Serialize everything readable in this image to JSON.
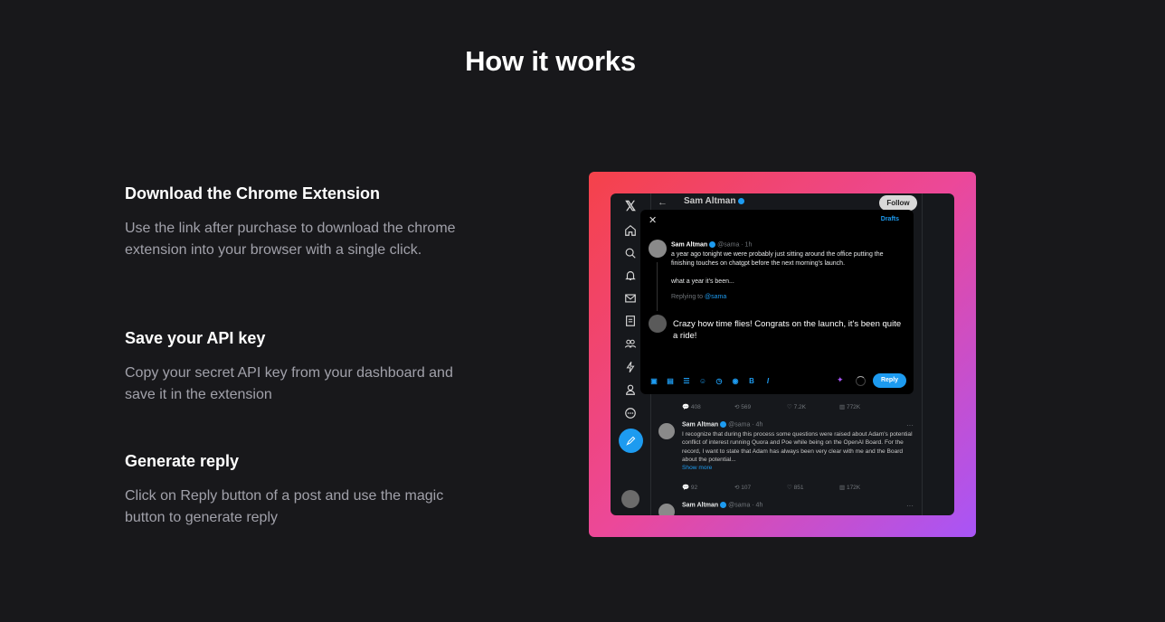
{
  "page": {
    "title": "How it works"
  },
  "steps": [
    {
      "title": "Download the Chrome Extension",
      "description": "Use the link after purchase to download the chrome extension into your browser with a single click."
    },
    {
      "title": "Save your API key",
      "description": "Copy your secret API key from your dashboard and save it in the extension"
    },
    {
      "title": "Generate reply",
      "description": "Click on Reply button of a post and use the magic button to generate reply"
    }
  ],
  "colors": {
    "background": "#18181b",
    "gradient_start": "#f5424a",
    "gradient_mid": "#ec4899",
    "gradient_end": "#a855f7",
    "twitter_blue": "#1d9bf0"
  },
  "screenshot": {
    "header_name": "Sam Altman",
    "follow_label": "Follow",
    "back_icon": "arrow-left-icon",
    "sidebar_icons": [
      "x-logo-icon",
      "home-icon",
      "search-icon",
      "bell-icon",
      "mail-icon",
      "list-icon",
      "communities-icon",
      "lightning-icon",
      "profile-icon",
      "more-icon",
      "compose-icon"
    ],
    "modal": {
      "close": "✕",
      "drafts_label": "Drafts",
      "tweet_author": "Sam Altman",
      "tweet_handle": "@sama · 1h",
      "tweet_text": "a year ago tonight we were probably just sitting around the office putting the finishing touches on chatgpt before the next morning's launch.",
      "tweet_text_2": "what a year it's been...",
      "replying_prefix": "Replying to",
      "replying_handle": "@sama",
      "draft_reply": "Crazy how time flies! Congrats on the launch, it's been quite a ride!",
      "toolbar_icons": [
        "image-icon",
        "gif-icon",
        "poll-icon",
        "emoji-icon",
        "schedule-icon",
        "location-icon",
        "bold-icon",
        "italic-icon"
      ],
      "reply_label": "Reply"
    },
    "post1_actions": {
      "replies": "408",
      "reposts": "569",
      "likes": "7.2K",
      "views": "772K"
    },
    "post2": {
      "author": "Sam Altman",
      "handle": "@sama · 4h",
      "text": "I recognize that during this process some questions were raised about Adam's potential conflict of interest running Quora and Poe while being on the OpenAI Board. For the record, I want to state that Adam has always been very clear with me and the Board about the potential...",
      "show_more": "Show more",
      "actions": {
        "replies": "92",
        "reposts": "107",
        "likes": "851",
        "views": "172K"
      }
    },
    "post3": {
      "author": "Sam Altman",
      "handle": "@sama · 4h"
    }
  }
}
